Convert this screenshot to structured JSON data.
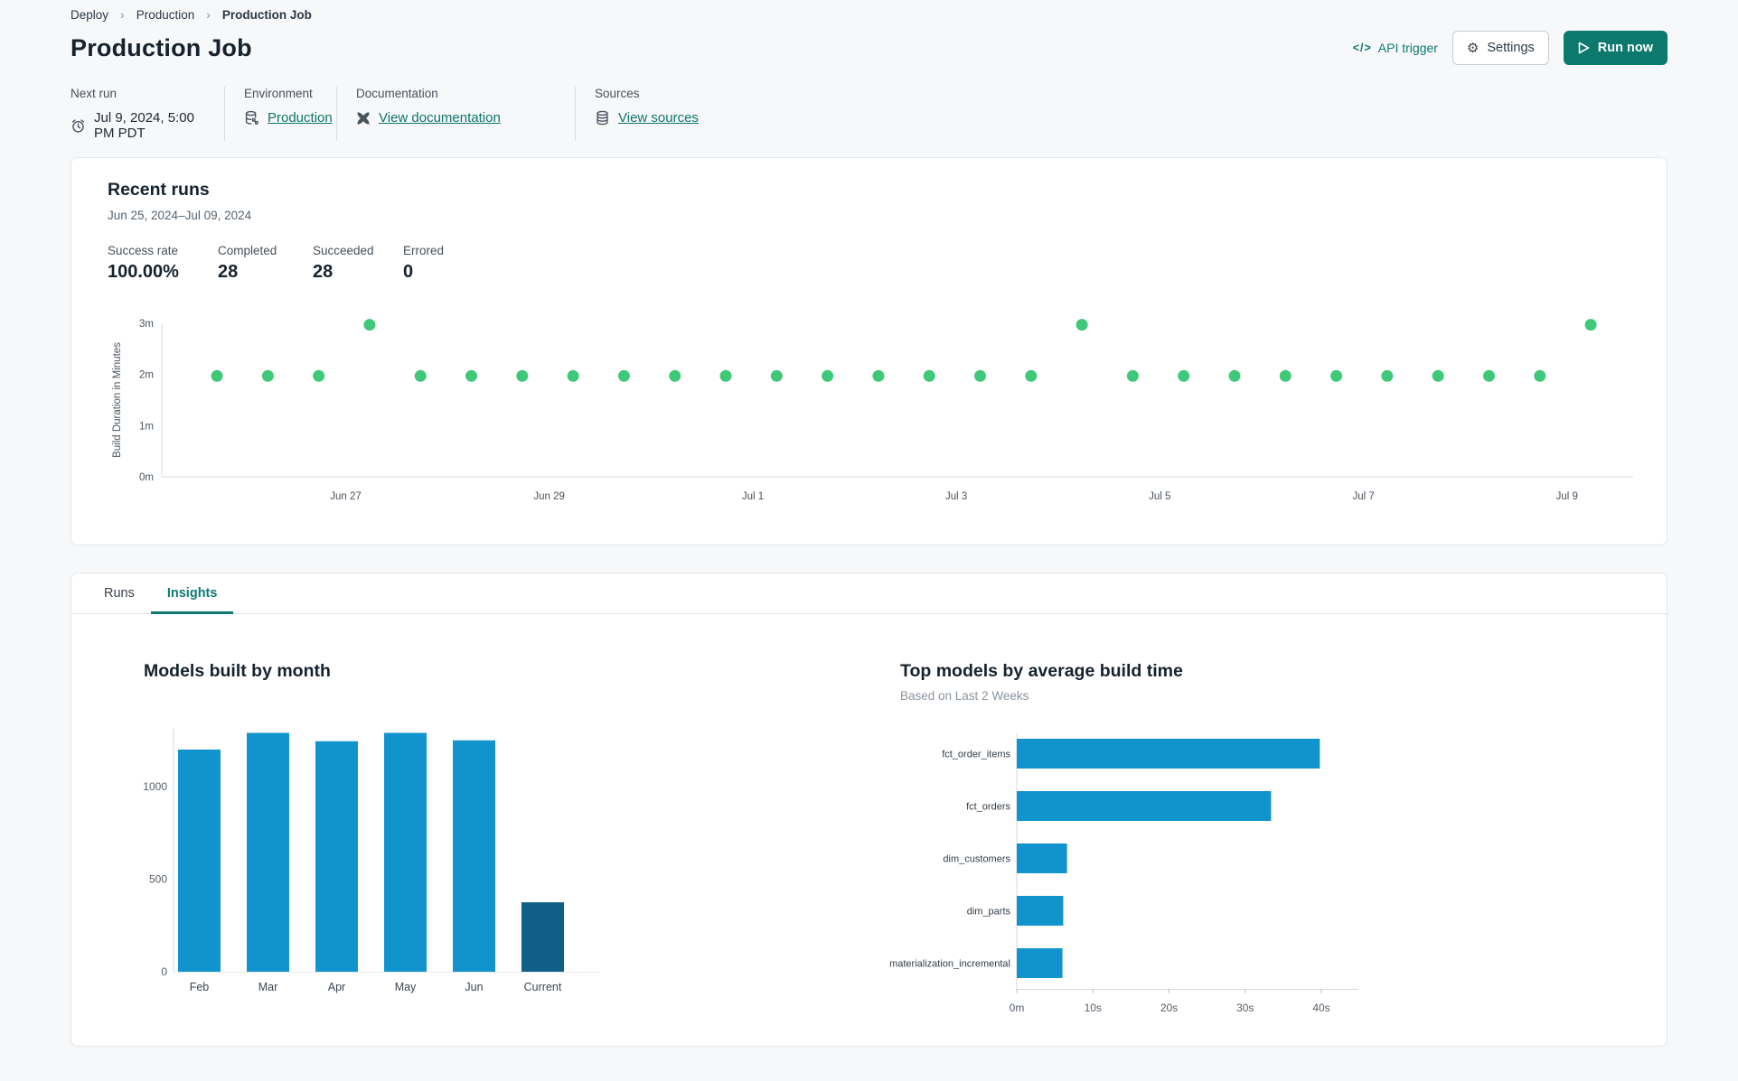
{
  "breadcrumb": {
    "items": [
      "Deploy",
      "Production",
      "Production Job"
    ],
    "separator": "›"
  },
  "header": {
    "title": "Production Job",
    "api_trigger_label": "API trigger",
    "api_icon_glyph": "</>",
    "settings_label": "Settings",
    "run_now_label": "Run now"
  },
  "info": {
    "columns": [
      {
        "label": "Next run",
        "value": "Jul 9, 2024, 5:00 PM PDT",
        "icon": "clock-icon",
        "is_link": false
      },
      {
        "label": "Environment",
        "value": "Production",
        "icon": "environment-icon",
        "is_link": true
      },
      {
        "label": "Documentation",
        "value": "View documentation",
        "icon": "docs-icon",
        "is_link": true
      },
      {
        "label": "Sources",
        "value": "View sources",
        "icon": "database-icon",
        "is_link": true
      }
    ]
  },
  "recent_runs": {
    "title": "Recent runs",
    "date_range": "Jun 25, 2024–Jul 09, 2024",
    "stats": [
      {
        "label": "Success rate",
        "value": "100.00%"
      },
      {
        "label": "Completed",
        "value": "28"
      },
      {
        "label": "Succeeded",
        "value": "28"
      },
      {
        "label": "Errored",
        "value": "0"
      }
    ]
  },
  "tabs": [
    {
      "label": "Runs",
      "active": false
    },
    {
      "label": "Insights",
      "active": true
    }
  ],
  "colors": {
    "accent_teal": "#0e7a70",
    "run_dot_green": "#3fc878",
    "bar_blue": "#1194ce",
    "bar_dark_blue": "#0f5f88",
    "axis_line": "#d6dadf",
    "tick_text": "#49535d"
  },
  "chart_data": [
    {
      "id": "recent-runs-duration",
      "type": "scatter",
      "title": "Recent runs",
      "ylabel": "Build Duration in Minutes",
      "ylim": [
        0,
        3.3
      ],
      "yticks": [
        {
          "v": 0,
          "label": "0m"
        },
        {
          "v": 1,
          "label": "1m"
        },
        {
          "v": 2,
          "label": "2m"
        },
        {
          "v": 3,
          "label": "3m"
        }
      ],
      "xtick_labels": [
        "Jun 27",
        "Jun 29",
        "Jul 1",
        "Jul 3",
        "Jul 5",
        "Jul 7",
        "Jul 9"
      ],
      "xtick_pos": [
        0.125,
        0.2633,
        0.4017,
        0.54,
        0.6783,
        0.8167,
        0.955
      ],
      "x_start": 0.0375,
      "x_step": 0.03458,
      "values": [
        1.97,
        1.97,
        1.97,
        2.97,
        1.97,
        1.97,
        1.97,
        1.97,
        1.97,
        1.97,
        1.97,
        1.97,
        1.97,
        1.97,
        1.97,
        1.97,
        1.97,
        2.97,
        1.97,
        1.97,
        1.97,
        1.97,
        1.97,
        1.97,
        1.97,
        1.97,
        1.97,
        2.97
      ],
      "point_color": "#3fc878",
      "grid": false
    },
    {
      "id": "models-built-by-month",
      "type": "bar",
      "title": "Models built by month",
      "categories": [
        "Feb",
        "Mar",
        "Apr",
        "May",
        "Jun",
        "Current"
      ],
      "values": [
        1200,
        1290,
        1245,
        1290,
        1250,
        375
      ],
      "bar_colors": [
        "#1194ce",
        "#1194ce",
        "#1194ce",
        "#1194ce",
        "#1194ce",
        "#0f5f88"
      ],
      "ylim": [
        0,
        1400
      ],
      "yticks": [
        0,
        500,
        1000
      ],
      "xlabel": "",
      "ylabel": ""
    },
    {
      "id": "top-models-by-avg-build-time",
      "type": "hbar",
      "title": "Top models by average build time",
      "subtitle": "Based on Last 2 Weeks",
      "categories": [
        "fct_order_items",
        "fct_orders",
        "dim_customers",
        "dim_parts",
        "materialization_incremental"
      ],
      "values": [
        39.8,
        33.4,
        6.6,
        6.1,
        6.0
      ],
      "value_unit": "seconds",
      "xlim": [
        0,
        45
      ],
      "xticks": [
        {
          "v": 0,
          "label": "0m"
        },
        {
          "v": 10,
          "label": "10s"
        },
        {
          "v": 20,
          "label": "20s"
        },
        {
          "v": 30,
          "label": "30s"
        },
        {
          "v": 40,
          "label": "40s"
        }
      ],
      "bar_color": "#1194ce"
    }
  ]
}
